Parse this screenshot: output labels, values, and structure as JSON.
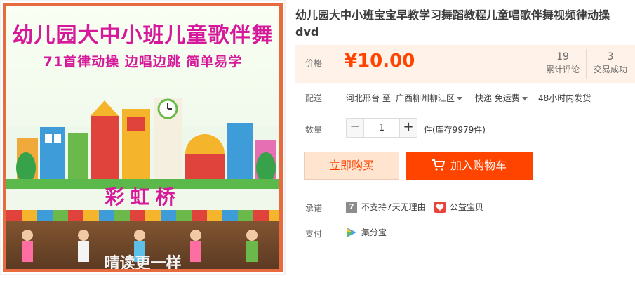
{
  "image": {
    "title": "幼儿园大中小班儿童歌伴舞",
    "subtitle": "71首律动操  边唱边跳  简单易学",
    "caption": "彩虹桥",
    "bottom_text": "晴读更一样"
  },
  "product": {
    "title": "幼儿园大中小班宝宝早教学习舞蹈教程儿童唱歌伴舞视频律动操dvd"
  },
  "price": {
    "label": "价格",
    "value": "¥10.00",
    "reviews_count": "19",
    "reviews_label": "累计评论",
    "deals_count": "3",
    "deals_label": "交易成功"
  },
  "shipping": {
    "label": "配送",
    "from": "河北邢台 至",
    "to": "广西柳州柳江区",
    "method": "快递 免运费",
    "dispatch": "48小时内发货"
  },
  "quantity": {
    "label": "数量",
    "minus": "−",
    "value": "1",
    "plus": "+",
    "stock": "件(库存9979件)"
  },
  "actions": {
    "buy_now": "立即购买",
    "add_to_cart": "加入购物车"
  },
  "promise": {
    "label": "承诺",
    "no_return_icon_text": "7",
    "no_return": "不支持7天无理由",
    "charity": "公益宝贝"
  },
  "payment": {
    "label": "支付",
    "method": "集分宝"
  },
  "colors": {
    "accent": "#ff4400",
    "price_bg": "#fff2e8",
    "buy_bg": "#ffe4d0",
    "image_border": "#e86a3f",
    "image_title": "#d6199a"
  }
}
